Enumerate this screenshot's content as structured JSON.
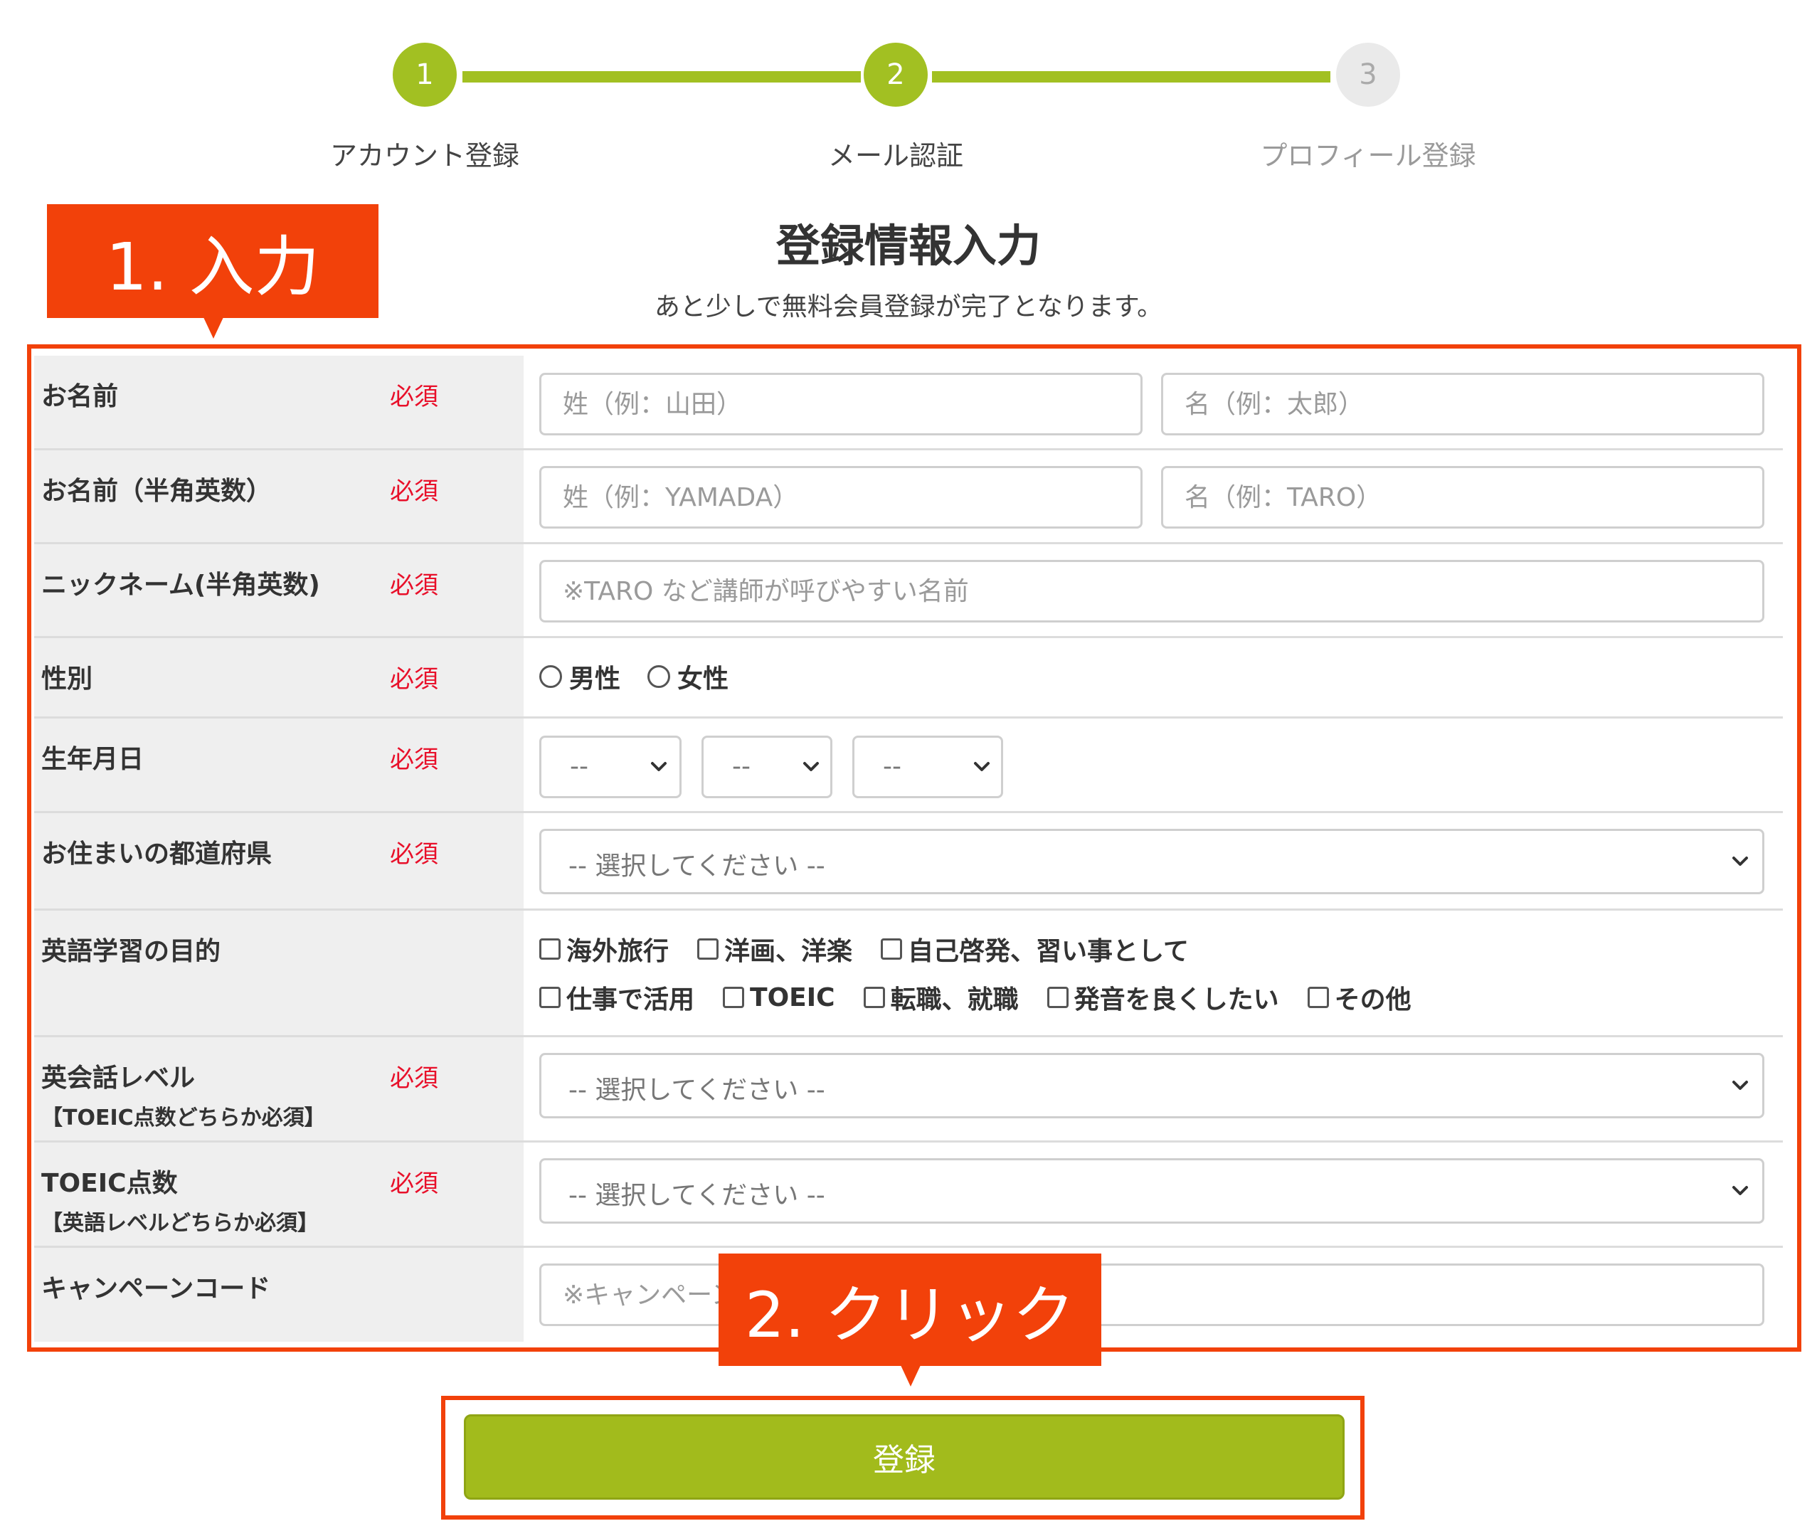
{
  "stepper": {
    "steps": [
      {
        "number": "1",
        "label": "アカウント登録",
        "state": "done"
      },
      {
        "number": "2",
        "label": "メール認証",
        "state": "current"
      },
      {
        "number": "3",
        "label": "プロフィール登録",
        "state": "upcoming"
      }
    ]
  },
  "heading": {
    "title": "登録情報入力",
    "subtitle": "あと少しで無料会員登録が完了となります。"
  },
  "required_badge": "必須",
  "form": {
    "name": {
      "label": "お名前",
      "last_placeholder": "姓（例：山田）",
      "first_placeholder": "名（例：太郎）"
    },
    "name_alpha": {
      "label": "お名前（半角英数）",
      "last_placeholder": "姓（例：YAMADA）",
      "first_placeholder": "名（例：TARO）"
    },
    "nickname": {
      "label": "ニックネーム(半角英数)",
      "placeholder": "※TARO など講師が呼びやすい名前"
    },
    "gender": {
      "label": "性別",
      "options": [
        "男性",
        "女性"
      ]
    },
    "birthdate": {
      "label": "生年月日",
      "year": "--",
      "month": "--",
      "day": "--"
    },
    "prefecture": {
      "label": "お住まいの都道府県",
      "value": "-- 選択してください --"
    },
    "purpose": {
      "label": "英語学習の目的",
      "options": [
        "海外旅行",
        "洋画、洋楽",
        "自己啓発、習い事として",
        "仕事で活用",
        "TOEIC",
        "転職、就職",
        "発音を良くしたい",
        "その他"
      ]
    },
    "english_level": {
      "label": "英会話レベル",
      "note": "【TOEIC点数どちらか必須】",
      "value": "-- 選択してください --"
    },
    "toeic_score": {
      "label": "TOEIC点数",
      "note": "【英語レベルどちらか必須】",
      "value": "-- 選択してください --"
    },
    "campaign_code": {
      "label": "キャンペーンコード",
      "placeholder": "※キャンペーンコード"
    }
  },
  "submit_label": "登録",
  "annotations": {
    "step1": "1. 入力",
    "step2": "2. クリック",
    "color": "#f2410a"
  },
  "colors": {
    "accent": "#a2c022",
    "required": "#e8102a"
  }
}
